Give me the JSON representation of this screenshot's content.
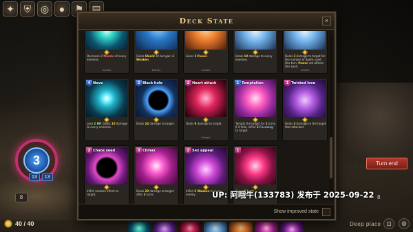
{
  "modal": {
    "title": "Deck State",
    "close": "×",
    "footer_label": "Show improved state"
  },
  "cards": [
    {
      "name": "",
      "cost": "",
      "text": [
        "Decrease ",
        {
          "hl": "red",
          "t": "2 Morale"
        },
        " of every enemies."
      ],
      "extract": "Extract",
      "art": "art-teal"
    },
    {
      "name": "",
      "cost": "",
      "text": [
        "Gains ",
        {
          "hl": "yellow",
          "t": "Shield"
        },
        " 10 but gain ",
        {
          "hl": "yellow",
          "t": "1 Weaken"
        },
        "."
      ],
      "extract": "Extract",
      "art": "art-blue-shield"
    },
    {
      "name": "",
      "cost": "",
      "text": [
        "Gains ",
        {
          "hl": "yellow",
          "t": "2 Power"
        },
        "."
      ],
      "extract": "Extract",
      "art": "art-orange"
    },
    {
      "name": "",
      "cost": "",
      "text": [
        "Deals ",
        {
          "hl": "yellow",
          "t": "10"
        },
        " damage to every enemies."
      ],
      "extract": "",
      "art": "art-lightblue"
    },
    {
      "name": "",
      "cost": "",
      "text": [
        "Deals ",
        {
          "hl": "yellow",
          "t": "2"
        },
        " damage to target for the number of Spells used this turn. ",
        {
          "hl": "yellow",
          "t": "Power"
        },
        " not affects this spell."
      ],
      "extract": "Extract",
      "art": "art-lightblue"
    },
    {
      "name": "Nova",
      "cost": "4",
      "costColor": "blue",
      "text": [
        "Lose ",
        {
          "hl": "green",
          "t": "2 HP"
        },
        ". Deals ",
        {
          "hl": "yellow",
          "t": "10"
        },
        " damage to every enemies."
      ],
      "extract": "",
      "art": "art-nova"
    },
    {
      "name": "Black hole",
      "cost": "3",
      "costColor": "blue",
      "text": [
        "Deals ",
        {
          "hl": "yellow",
          "t": "24"
        },
        " damage to target."
      ],
      "extract": "",
      "art": "art-blackhole"
    },
    {
      "name": "Heart attack",
      "cost": "2",
      "costColor": "pink",
      "text": [
        "Deals ",
        {
          "hl": "yellow",
          "t": "8"
        },
        " damage to target."
      ],
      "extract": "Extract",
      "art": "art-heart-attack"
    },
    {
      "name": "Temptation",
      "cost": "1",
      "costColor": "blue",
      "text": [
        "Tempts the target for ",
        {
          "hl": "yellow",
          "t": "2"
        },
        " turns. If it fails, inflict ",
        {
          "hl": "yellow",
          "t": "2"
        },
        " ",
        {
          "hl": "blue",
          "t": "Focusing"
        },
        " to target."
      ],
      "extract": "",
      "art": "art-temptation"
    },
    {
      "name": "Twisted love",
      "cost": "1",
      "costColor": "pink",
      "text": [
        "Deals ",
        {
          "hl": "yellow",
          "t": "3"
        },
        " damage to the target that attacked."
      ],
      "extract": "",
      "art": "art-twisted"
    },
    {
      "name": "Chaos seed",
      "cost": "2",
      "costColor": "pink",
      "text": [
        "Inflict random effect to target."
      ],
      "extract": "",
      "art": "art-chaos"
    },
    {
      "name": "Climax",
      "cost": "3",
      "costColor": "pink",
      "text": [
        "Deals ",
        {
          "hl": "yellow",
          "t": "20"
        },
        " damage to target after ",
        {
          "hl": "yellow",
          "t": "3"
        },
        " turns."
      ],
      "extract": "",
      "art": "art-climax"
    },
    {
      "name": "Sex appeal",
      "cost": "2",
      "costColor": "pink",
      "text": [
        "Inflict ",
        {
          "hl": "yellow",
          "t": "2 Weaken"
        },
        " to every enemy."
      ],
      "extract": "Extract",
      "art": "art-sexappeal"
    },
    {
      "name": "",
      "cost": "1",
      "costColor": "pink",
      "text": [
        "Gains ",
        {
          "hl": "yellow",
          "t": "5 Lust"
        },
        "."
      ],
      "extract": "",
      "art": "art-seduce"
    }
  ],
  "hud": {
    "hp_value": "40 / 40",
    "hero_level": "3",
    "hero_stat_a": "13",
    "hero_stat_b": "13",
    "turn_end_label": "Turn end",
    "location_label": "Deep place",
    "deck_count": "8",
    "left_pile": "8"
  },
  "top_icons": [
    "crest-icon",
    "shield-icon",
    "ring-icon",
    "orb-icon",
    "torch-icon",
    "book-icon"
  ],
  "watermark": "UP: 阿哦牛(133783) 发布于 2025-09-22"
}
